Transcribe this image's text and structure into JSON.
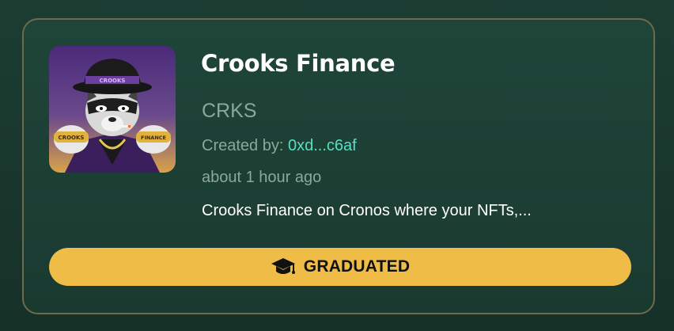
{
  "token": {
    "name": "Crooks Finance",
    "ticker": "CRKS",
    "created_by_label": "Created by: ",
    "creator_address": "0xd...c6af",
    "time_ago": "about 1 hour ago",
    "description": "Crooks Finance on Cronos where your NFTs,..."
  },
  "avatar": {
    "hat_band_text": "CROOKS",
    "left_ring_text": "CROOKS",
    "right_ring_text": "FINANCE"
  },
  "status": {
    "label": "GRADUATED",
    "icon": "graduation-cap-icon"
  },
  "colors": {
    "page_bg": "#1c3d33",
    "card_bg": "#1f4539",
    "card_border": "#6f6a4c",
    "muted_text": "#8ca79c",
    "accent_link": "#54e0c2",
    "badge_bg": "#efbd47"
  }
}
